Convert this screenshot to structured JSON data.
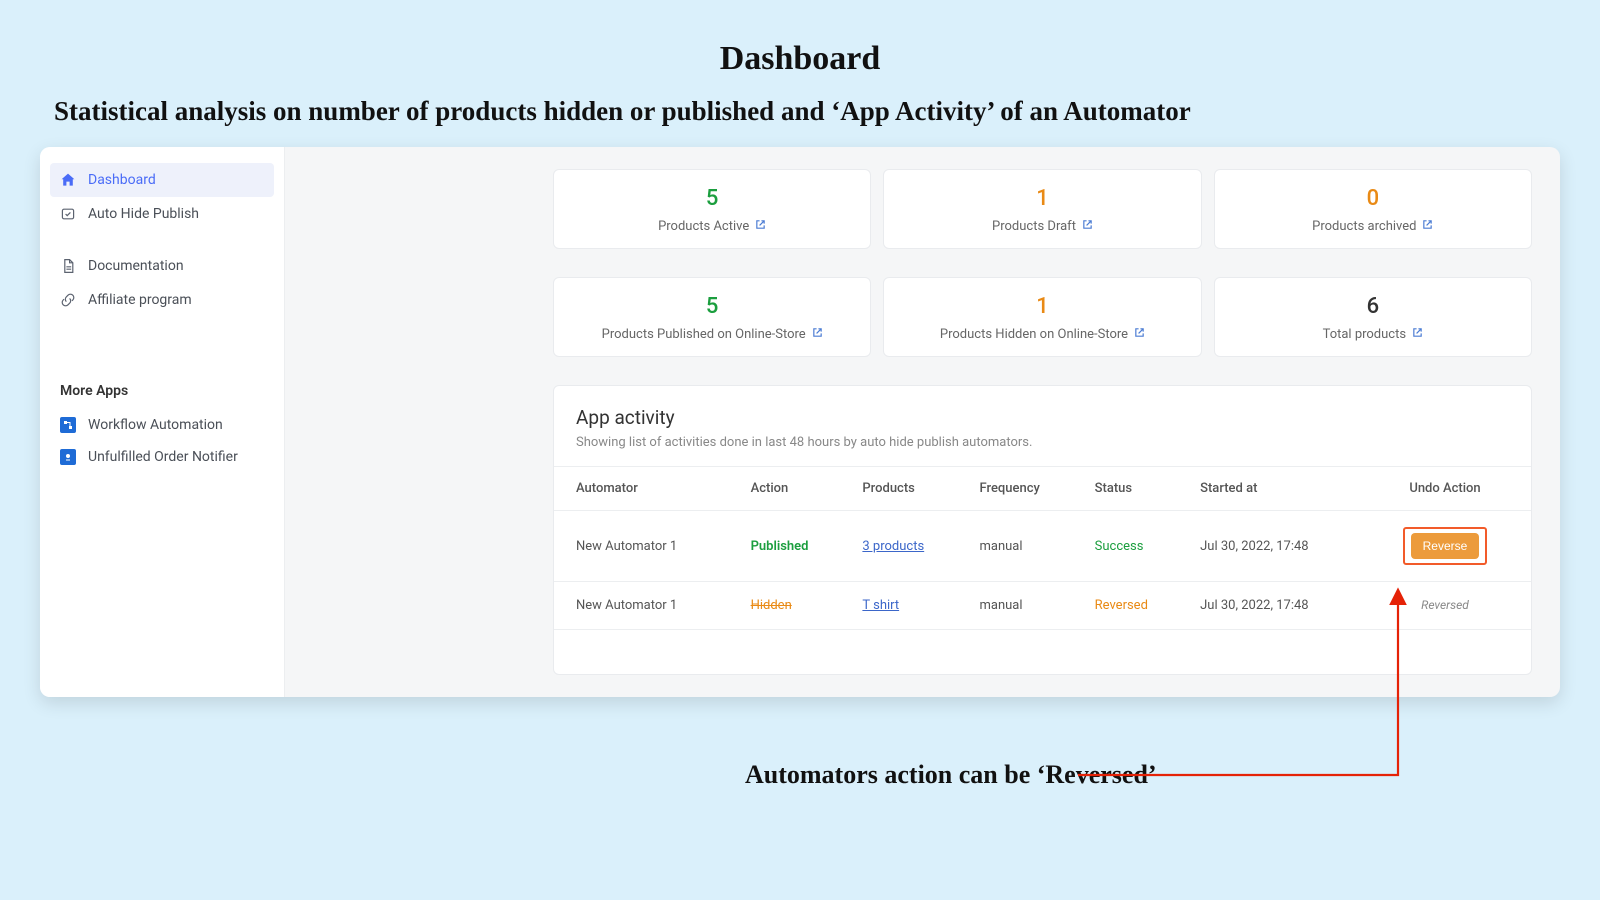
{
  "header": {
    "title": "Dashboard",
    "subtitle": "Statistical analysis on number of products hidden or published  and ‘App Activity’ of an Automator"
  },
  "sidebar": {
    "items": [
      {
        "label": "Dashboard",
        "icon": "home-icon",
        "active": true
      },
      {
        "label": "Auto Hide Publish",
        "icon": "loop-icon",
        "active": false
      },
      {
        "label": "Documentation",
        "icon": "doc-icon",
        "active": false
      },
      {
        "label": "Affiliate program",
        "icon": "link-icon",
        "active": false
      }
    ],
    "more_apps_title": "More Apps",
    "apps": [
      {
        "label": "Workflow Automation"
      },
      {
        "label": "Unfulfilled Order Notifier"
      }
    ]
  },
  "stats_row1": [
    {
      "value": "5",
      "label": "Products Active",
      "color": "green"
    },
    {
      "value": "1",
      "label": "Products Draft",
      "color": "orange"
    },
    {
      "value": "0",
      "label": "Products archived",
      "color": "orange"
    }
  ],
  "stats_row2": [
    {
      "value": "5",
      "label": "Products Published on Online-Store",
      "color": "green"
    },
    {
      "value": "1",
      "label": "Products Hidden on Online-Store",
      "color": "orange"
    },
    {
      "value": "6",
      "label": "Total products",
      "color": "gray"
    }
  ],
  "activity": {
    "title": "App activity",
    "desc": "Showing list of activities done in last 48 hours by auto hide publish automators.",
    "columns": [
      "Automator",
      "Action",
      "Products",
      "Frequency",
      "Status",
      "Started at",
      "Undo Action"
    ],
    "rows": [
      {
        "automator": "New Automator 1",
        "action": "Published",
        "action_style": "published",
        "products": "3 products",
        "frequency": "manual",
        "status": "Success",
        "status_style": "success",
        "started": "Jul 30, 2022, 17:48",
        "undo_type": "button",
        "undo_label": "Reverse"
      },
      {
        "automator": "New Automator 1",
        "action": "Hidden",
        "action_style": "hidden",
        "products": "T shirt",
        "frequency": "manual",
        "status": "Reversed",
        "status_style": "reversed",
        "started": "Jul 30, 2022, 17:48",
        "undo_type": "text",
        "undo_label": "Reversed"
      }
    ]
  },
  "callout": {
    "text": "Automators action can be ‘Reversed’"
  }
}
